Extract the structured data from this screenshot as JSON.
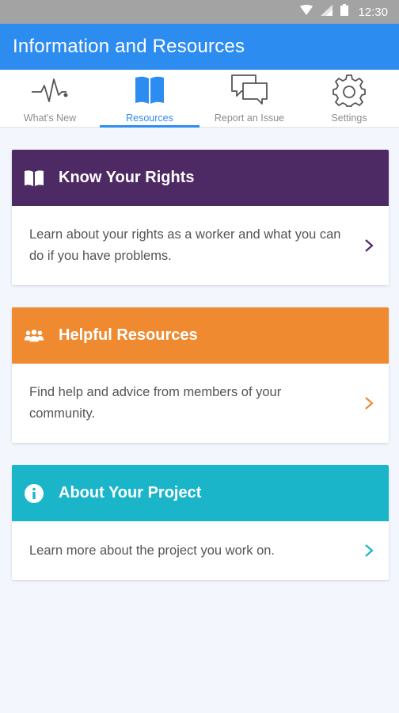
{
  "status_bar": {
    "time": "12:30"
  },
  "app_bar": {
    "title": "Information and Resources"
  },
  "tabs": [
    {
      "label": "What's New",
      "icon": "heartbeat-icon"
    },
    {
      "label": "Resources",
      "icon": "open-book-icon",
      "active": true
    },
    {
      "label": "Report an Issue",
      "icon": "chat-bubbles-icon"
    },
    {
      "label": "Settings",
      "icon": "gear-icon"
    }
  ],
  "cards": [
    {
      "title": "Know Your Rights",
      "description": "Learn about your rights as a worker and what you can do if you have problems.",
      "color": "#4e2a64",
      "icon": "book-icon"
    },
    {
      "title": "Helpful Resources",
      "description": "Find help and advice from members of your community.",
      "color": "#ef8a30",
      "icon": "people-icon"
    },
    {
      "title": "About Your Project",
      "description": "Learn more about the project you work on.",
      "color": "#1ab5c9",
      "icon": "info-icon"
    }
  ],
  "colors": {
    "primary": "#2d8cf0",
    "background": "#f3f6fc"
  }
}
